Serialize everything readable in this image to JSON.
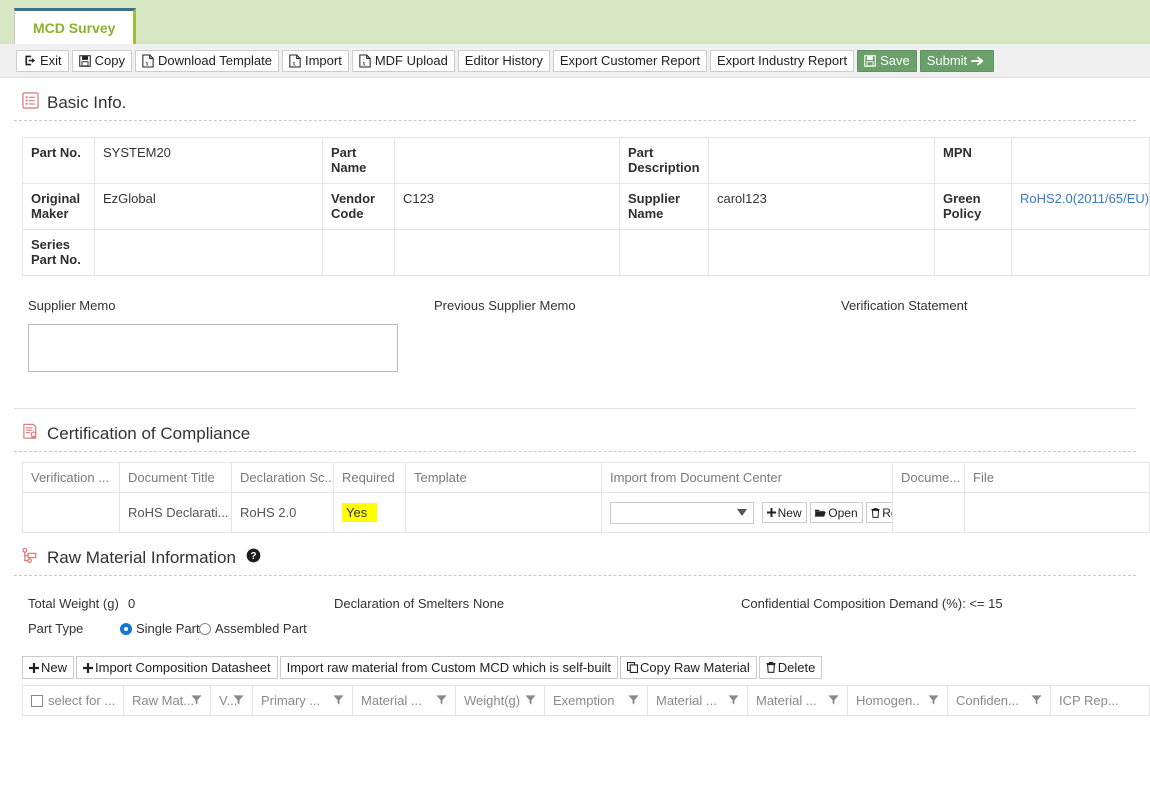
{
  "tab": {
    "label": "MCD Survey"
  },
  "toolbar": {
    "buttons": [
      {
        "label": "Exit",
        "icon": "exit-icon",
        "style": "plain"
      },
      {
        "label": "Copy",
        "icon": "save-disk-icon",
        "style": "plain"
      },
      {
        "label": "Download Template",
        "icon": "excel-file-icon",
        "style": "plain"
      },
      {
        "label": "Import",
        "icon": "excel-file-icon",
        "style": "plain"
      },
      {
        "label": "MDF Upload",
        "icon": "excel-file-icon",
        "style": "plain"
      },
      {
        "label": "Editor History",
        "icon": "none",
        "style": "plain"
      },
      {
        "label": "Export Customer Report",
        "icon": "none",
        "style": "plain"
      },
      {
        "label": "Export Industry Report",
        "icon": "none",
        "style": "plain"
      },
      {
        "label": "Save",
        "icon": "save-disk-icon",
        "style": "green"
      },
      {
        "label": "Submit",
        "icon": "arrow-right-icon",
        "style": "green"
      }
    ]
  },
  "basic_info": {
    "heading": "Basic Info.",
    "rows": [
      {
        "label1": "Part No.",
        "value1": "SYSTEM20",
        "label2": "Part Name",
        "value2": "",
        "label3": "Part Description",
        "value3": "",
        "label4": "MPN",
        "value4": "",
        "value4_link": false
      },
      {
        "label1": "Original Maker",
        "value1": "EzGlobal",
        "label2": "Vendor Code",
        "value2": "C123",
        "label3": "Supplier Name",
        "value3": "carol123",
        "label4": "Green Policy",
        "value4": "RoHS2.0(2011/65/EU)",
        "value4_link": true
      },
      {
        "label1": "Series Part No.",
        "value1": "",
        "label2": "",
        "value2": "",
        "label3": "",
        "value3": "",
        "label4": "",
        "value4": "",
        "value4_link": false
      }
    ],
    "memo": {
      "supplier_memo_label": "Supplier Memo",
      "supplier_memo_value": "",
      "previous_supplier_memo_label": "Previous Supplier Memo",
      "verification_statement_label": "Verification Statement"
    }
  },
  "certification": {
    "heading": "Certification of Compliance",
    "columns": [
      "Verification ...",
      "Document Title",
      "Declaration Sc...",
      "Required",
      "Template",
      "Import from Document Center",
      "Docume...",
      "File"
    ],
    "row": {
      "verification": "",
      "document_title": "RoHS Declarati...",
      "declaration_scope": "RoHS 2.0",
      "required": "Yes",
      "template": "",
      "select_value": "",
      "new_label": "New",
      "open_label": "Open",
      "reset_label": "Reset",
      "document": "",
      "file": ""
    }
  },
  "raw_material": {
    "heading": "Raw Material Information",
    "help_icon": "help-circle-icon",
    "total_weight_label": "Total Weight (g)",
    "total_weight_value": "0",
    "declaration_smelters_label": "Declaration of Smelters",
    "declaration_smelters_value": "None",
    "confidential_label": "Confidential Composition Demand (%): <= 15",
    "part_type_label": "Part Type",
    "part_type_options": [
      "Single Part",
      "Assembled Part"
    ],
    "part_type_selected": "Single Part",
    "actions": [
      {
        "label": "New",
        "icon": "plus-icon"
      },
      {
        "label": "Import Composition Datasheet",
        "icon": "plus-icon"
      },
      {
        "label": "Import raw material from Custom MCD which is self-built",
        "icon": "none"
      },
      {
        "label": "Copy Raw Material",
        "icon": "copy-icon"
      },
      {
        "label": "Delete",
        "icon": "trash-icon"
      }
    ],
    "grid_columns": [
      {
        "label": "select for ...",
        "checkbox": true,
        "filter": false
      },
      {
        "label": "Raw Mat...",
        "checkbox": false,
        "filter": true
      },
      {
        "label": "V...",
        "checkbox": false,
        "filter": true
      },
      {
        "label": "Primary ...",
        "checkbox": false,
        "filter": true
      },
      {
        "label": "Material ...",
        "checkbox": false,
        "filter": true
      },
      {
        "label": "Weight(g)",
        "checkbox": false,
        "filter": true
      },
      {
        "label": "Exemption",
        "checkbox": false,
        "filter": true
      },
      {
        "label": "Material ...",
        "checkbox": false,
        "filter": true
      },
      {
        "label": "Material ...",
        "checkbox": false,
        "filter": true
      },
      {
        "label": "Homogen..",
        "checkbox": false,
        "filter": true
      },
      {
        "label": "Confiden...",
        "checkbox": false,
        "filter": true
      },
      {
        "label": "ICP Rep...",
        "checkbox": false,
        "filter": false
      }
    ]
  },
  "colors": {
    "tab_bar": "#d7e6c2",
    "tab_text": "#8ab32a",
    "tab_top_border": "#3b6e8f",
    "green_button": "#6aa06a",
    "link": "#3b78c3",
    "highlight": "#ffff00",
    "section_icon": "#e8a0a0"
  }
}
